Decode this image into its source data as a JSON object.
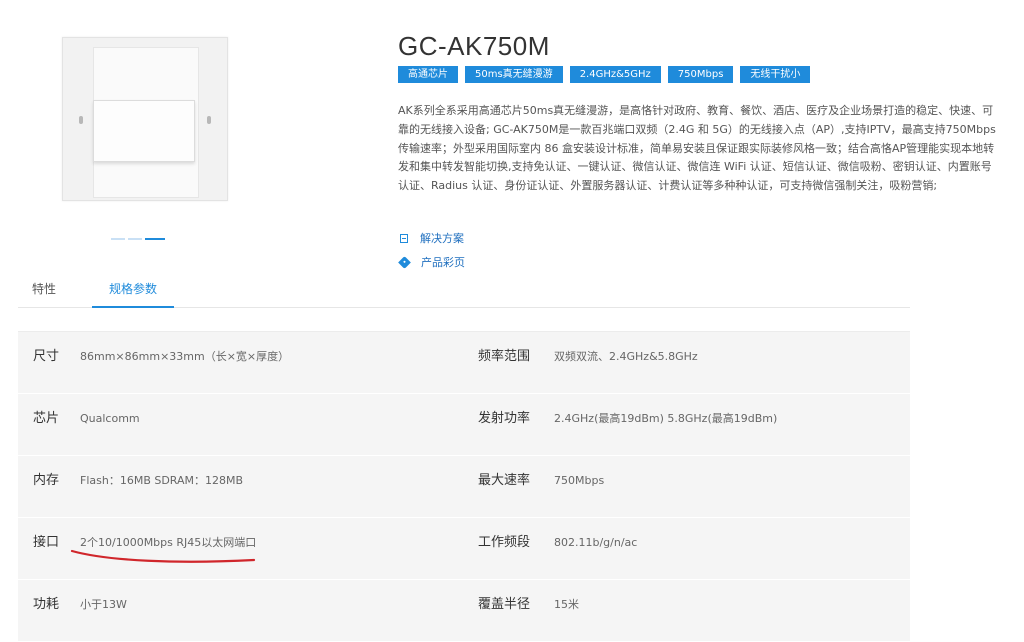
{
  "product": {
    "title": "GC-AK750M",
    "tags": [
      "高通芯片",
      "50ms真无缝漫游",
      "2.4GHz&5GHz",
      "750Mbps",
      "无线干扰小"
    ],
    "description": "AK系列全系采用高通芯片50ms真无缝漫游，是高恪针对政府、教育、餐饮、酒店、医疗及企业场景打造的稳定、快速、可靠的无线接入设备; GC-AK750M是一款百兆端口双频（2.4G 和 5G）的无线接入点（AP）,支持IPTV，最高支持750Mbps传输速率；外型采用国际室内 86 盒安装设计标准，简单易安装且保证跟实际装修风格一致；结合高恪AP管理能实现本地转发和集中转发智能切换,支持免认证、一键认证、微信认证、微信连 WiFi 认证、短信认证、微信吸粉、密钥认证、内置账号认证、Radius 认证、身份证认证、外置服务器认证、计费认证等多种种认证，可支持微信强制关注，吸粉营销;",
    "links": [
      {
        "label": "解决方案",
        "icon": "document-icon"
      },
      {
        "label": "产品彩页",
        "icon": "tag-icon"
      }
    ]
  },
  "tabs": [
    {
      "label": "特性",
      "active": false
    },
    {
      "label": "规格参数",
      "active": true
    }
  ],
  "specs": [
    {
      "label": "尺寸",
      "value": "86mm×86mm×33mm（长×宽×厚度）",
      "label2": "频率范围",
      "value2": "双频双流、2.4GHz&5.8GHz"
    },
    {
      "label": "芯片",
      "value": "Qualcomm",
      "label2": "发射功率",
      "value2": "2.4GHz(最高19dBm) 5.8GHz(最高19dBm)"
    },
    {
      "label": "内存",
      "value": "Flash：16MB SDRAM：128MB",
      "label2": "最大速率",
      "value2": "750Mbps"
    },
    {
      "label": "接口",
      "value": "2个10/1000Mbps RJ45以太网端口",
      "label2": "工作频段",
      "value2": "802.11b/g/n/ac"
    },
    {
      "label": "功耗",
      "value": "小于13W",
      "label2": "覆盖半径",
      "value2": "15米"
    }
  ],
  "colors": {
    "accent": "#1f8bdb",
    "annotation": "#d0262b"
  }
}
